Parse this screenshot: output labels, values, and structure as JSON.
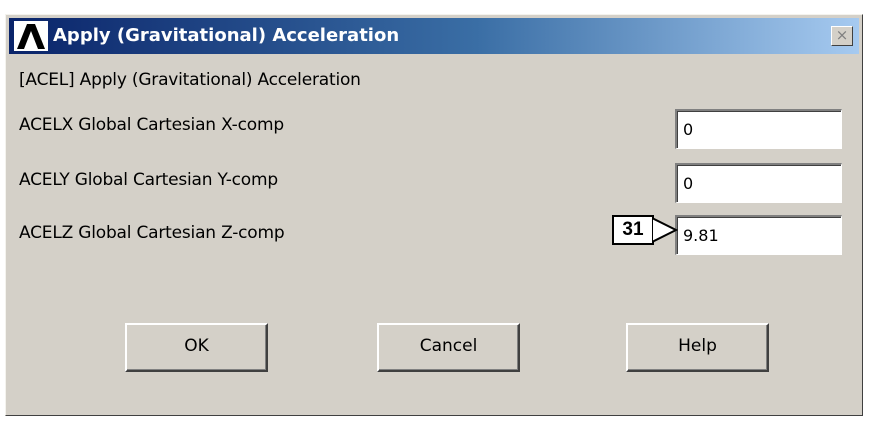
{
  "window": {
    "title": "Apply (Gravitational) Acceleration",
    "close_glyph": "×"
  },
  "form": {
    "heading": "[ACEL]  Apply (Gravitational) Acceleration",
    "fields": [
      {
        "label": "ACELX  Global Cartesian X-comp",
        "value": "0"
      },
      {
        "label": "ACELY  Global Cartesian Y-comp",
        "value": "0"
      },
      {
        "label": "ACELZ  Global Cartesian Z-comp",
        "value": "9.81"
      }
    ]
  },
  "callout": {
    "number": "31"
  },
  "buttons": {
    "ok": "OK",
    "cancel": "Cancel",
    "help": "Help"
  },
  "icons": {
    "app": "ansys-logo-icon",
    "close": "close-icon",
    "callout_arrow": "arrow-right-icon"
  },
  "colors": {
    "titlebar_start": "#0a246a",
    "titlebar_end": "#a6caf0",
    "dialog_bg": "#d4d0c8"
  }
}
